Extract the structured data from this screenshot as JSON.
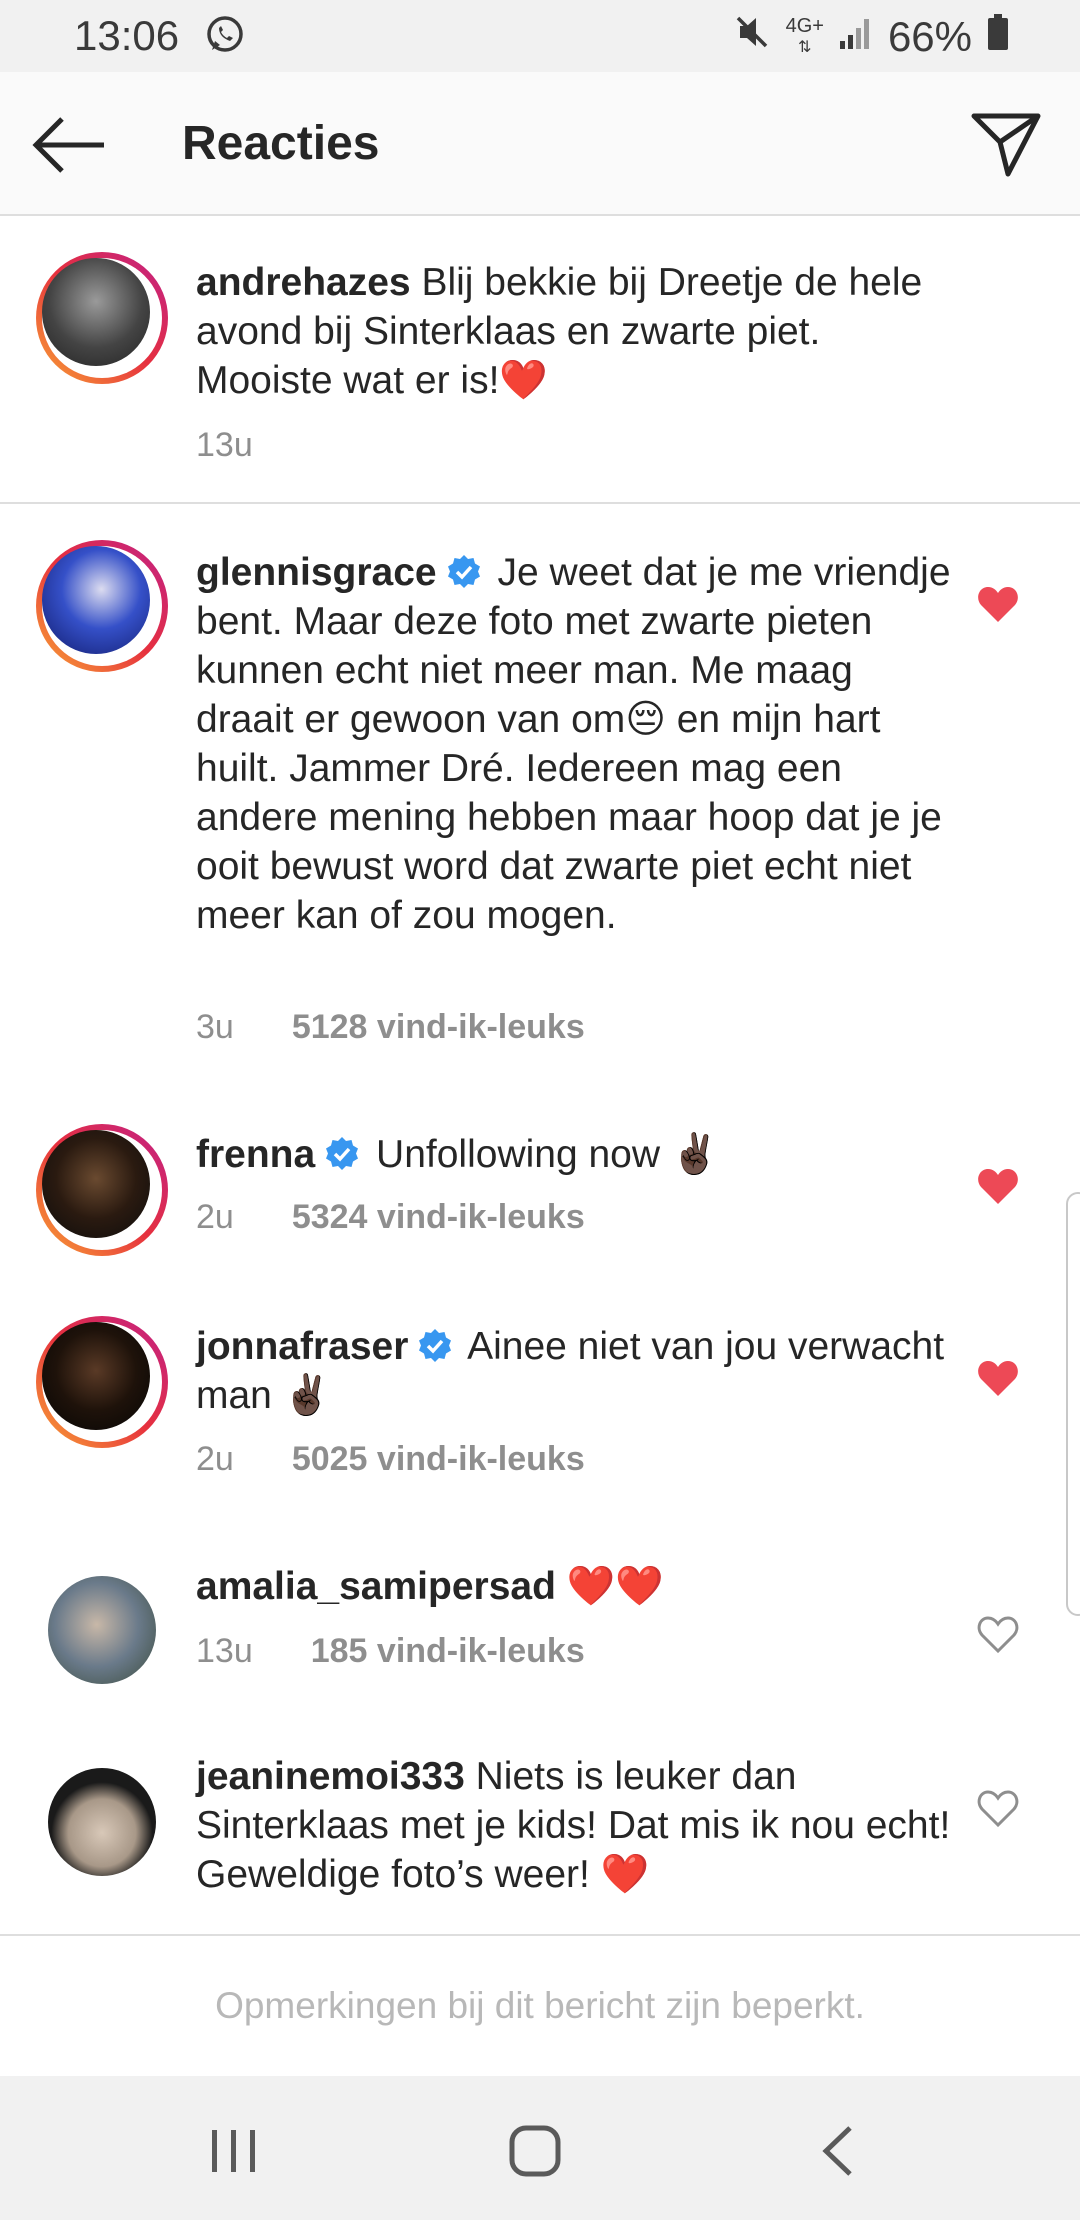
{
  "status_bar": {
    "time": "13:06",
    "network": "4G+",
    "battery": "66%",
    "icons": [
      "whatsapp-icon",
      "mute-icon",
      "signal-icon",
      "battery-icon"
    ]
  },
  "header": {
    "title": "Reacties",
    "icons": [
      "back-arrow-icon",
      "send-icon"
    ]
  },
  "caption": {
    "username": "andrehazes",
    "text": "Blij bekkie bij Dreetje de hele avond bij Sinterklaas en zwarte piet. Mooiste wat er is!❤️",
    "time": "13u"
  },
  "comments": [
    {
      "username": "glennisgrace",
      "verified": true,
      "text": "Je weet dat je me vriendje bent. Maar deze foto met zwarte pieten kunnen echt niet meer man. Me maag draait er gewoon van om😔 en mijn hart huilt. Jammer Dré. Iedereen mag een andere mening hebben maar hoop dat je je ooit bewust word dat zwarte piet echt niet meer kan of zou mogen.",
      "time": "3u",
      "likes": "5128 vind-ik-leuks",
      "liked": true
    },
    {
      "username": "frenna",
      "verified": true,
      "text": "Unfollowing now ✌🏿",
      "time": "2u",
      "likes": "5324 vind-ik-leuks",
      "liked": true
    },
    {
      "username": "jonnafraser",
      "verified": true,
      "text": "Ainee niet van jou verwacht man ✌🏿",
      "time": "2u",
      "likes": "5025 vind-ik-leuks",
      "liked": true
    },
    {
      "username": "amalia_samipersad",
      "verified": false,
      "text": "❤️❤️",
      "time": "13u",
      "likes": "185 vind-ik-leuks",
      "liked": false
    },
    {
      "username": "jeaninemoi333",
      "verified": false,
      "text": "Niets is leuker dan Sinterklaas met je kids! Dat mis ik nou echt! Geweldige foto’s weer! ❤️",
      "liked": false
    }
  ],
  "footer": {
    "restricted_text": "Opmerkingen bij dit bericht zijn beperkt."
  },
  "nav_bar": {
    "icons": [
      "recent-apps-icon",
      "home-icon",
      "back-icon"
    ]
  },
  "colors": {
    "like_red": "#ed4956",
    "verified_blue": "#3897f0",
    "secondary_text": "#8e8e8e"
  }
}
